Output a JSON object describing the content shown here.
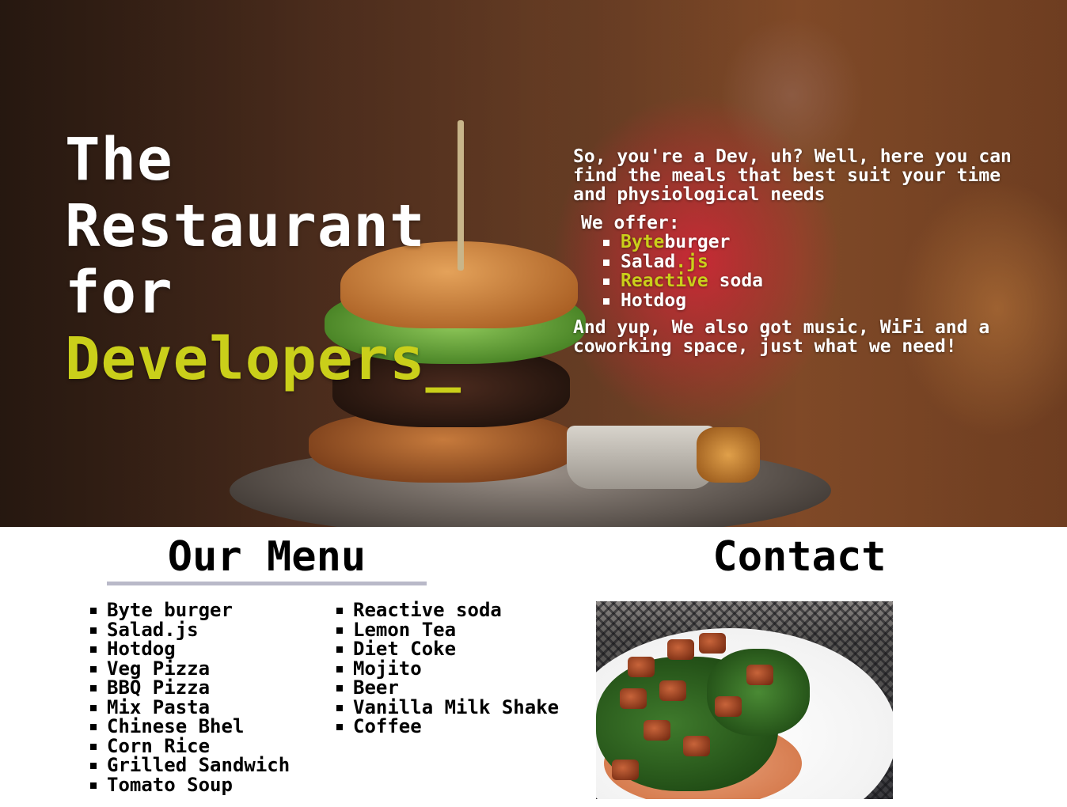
{
  "hero": {
    "title_line1": "The",
    "title_line2": "Restaurant",
    "title_line3": "for",
    "title_line4": "Developers_",
    "intro": "So, you're a Dev, uh? Well, here you can find the meals that best suit your time and physiological needs",
    "offer_title": "We offer:",
    "offers": [
      {
        "highlight": "Byte",
        "rest": "burger"
      },
      {
        "prefix": "Salad",
        "highlight": ".js"
      },
      {
        "highlight": "Reactive",
        "rest": " soda"
      },
      {
        "prefix": "Hotdog"
      }
    ],
    "outro": "And yup, We also got music, WiFi and a coworking space, just what we need!",
    "accent_color": "#cacf1a"
  },
  "menu": {
    "heading": "Our Menu",
    "column1": [
      "Byte burger",
      "Salad.js",
      "Hotdog",
      "Veg Pizza",
      "BBQ Pizza",
      "Mix Pasta",
      "Chinese Bhel",
      "Corn Rice",
      "Grilled Sandwich",
      "Tomato Soup"
    ],
    "column2": [
      "Reactive soda",
      "Lemon Tea",
      "Diet Coke",
      "Mojito",
      "Beer",
      "Vanilla Milk Shake",
      "Coffee"
    ]
  },
  "contact": {
    "heading": "Contact"
  }
}
